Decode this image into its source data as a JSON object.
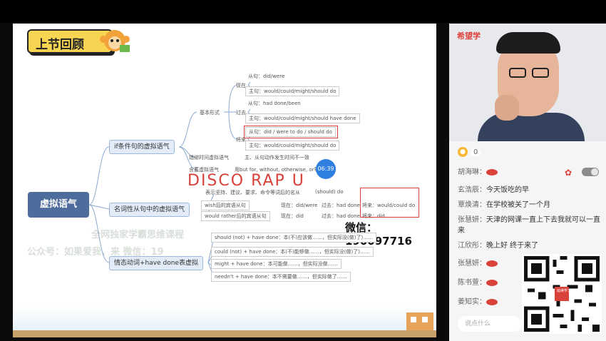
{
  "slide": {
    "title": "上节回顾",
    "root": "虚拟语气",
    "branches": [
      "if条件句的虚拟语气",
      "名词性从句中的虚拟语气",
      "情态动词+have done表虚拟"
    ],
    "sub1": {
      "basic": "基本形式",
      "present": "现在",
      "past": "过去",
      "future": "将来",
      "items": [
        "从句：did/were",
        "主句：would/could/might/should do",
        "从句：had done/been",
        "主句：would/could/might/should have done",
        "从句：did / were to do / should do",
        "主句：would/could/might/should do"
      ],
      "mixed": "错综时间虚拟语气",
      "mixed_desc": "主、从句动作发生时间不一致",
      "implied": "含蓄虚拟语气",
      "implied_desc": "用but for, without, otherwise, or等"
    },
    "sub2": {
      "suggest": "表示坚持、建议、要求、命令等词后的名从",
      "suggest_form": "(should) do",
      "wish": "wish后的宾语从句",
      "wish_now": "现在：did/were",
      "wish_past": "过去：had done",
      "wish_future": "将来：would/could do",
      "rather": "would rather后的宾语从句",
      "rather_now": "现在：did",
      "rather_past": "过去：had done",
      "rather_future": "将来：did"
    },
    "sub3": [
      "should (not) + have done：本(不)应该做……，但实际没(做)了)……",
      "could (not) + have done：本(不)能够做……，但实际没(做)了)……",
      "might + have done：本可能做……，但实际没做……",
      "needn't + have done：本不需要做……，但实际做了……"
    ],
    "handwriting": "DISCO RAP U",
    "timer": "06:39",
    "watermark": "微信：190097716",
    "ghost1": "全网独家学霸思维课程",
    "ghost2": "公众号：如果爱我，来 微信：19"
  },
  "panel": {
    "brand": "希望学",
    "likes": "0",
    "messages": [
      {
        "name": "胡海琳：",
        "text": ""
      },
      {
        "name": "玄浩辰：",
        "text": "今天饭吃的早"
      },
      {
        "name": "覃焕清：",
        "text": "在学校被关了一个月"
      },
      {
        "name": "张慧妍：",
        "text": "天津的网课一直上下去我就可以一直来"
      },
      {
        "name": "江欣彤：",
        "text": "晚上好 终于来了"
      },
      {
        "name": "张慧妍：",
        "text": ""
      },
      {
        "name": "陈书萱：",
        "text": ""
      },
      {
        "name": "姜知实：",
        "text": ""
      }
    ],
    "input_placeholder": "说点什么",
    "qr_label": "延续学习"
  }
}
